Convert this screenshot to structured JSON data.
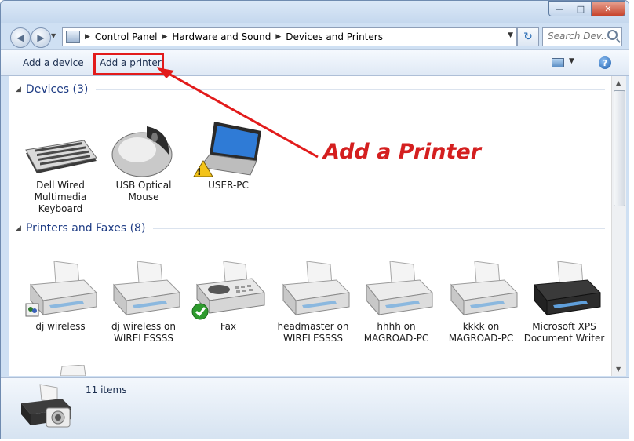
{
  "window": {
    "minimize": "—",
    "maximize": "□",
    "close": "✕"
  },
  "nav": {
    "back_icon": "◀",
    "forward_icon": "▶",
    "dropdown_icon": "▼",
    "refresh_icon": "↻"
  },
  "breadcrumb": {
    "items": [
      "Control Panel",
      "Hardware and Sound",
      "Devices and Printers"
    ],
    "separator": "▶"
  },
  "search": {
    "placeholder": "Search Dev..."
  },
  "toolbar": {
    "add_device": "Add a device",
    "add_printer": "Add a printer",
    "view_dropdown": "▼",
    "help": "?"
  },
  "groups": {
    "devices": {
      "arrow": "◢",
      "title": "Devices (3)",
      "items": [
        "Dell Wired Multimedia Keyboard",
        "USB Optical Mouse",
        "USER-PC"
      ]
    },
    "printers": {
      "arrow": "◢",
      "title": "Printers and Faxes (8)",
      "items": [
        "dj wireless",
        "dj wireless on WIRELESSSS",
        "Fax",
        "headmaster on WIRELESSSS",
        "hhhh on MAGROAD-PC",
        "kkkk on MAGROAD-PC",
        "Microsoft XPS Document Writer"
      ]
    }
  },
  "scroll": {
    "up": "▲",
    "down": "▼"
  },
  "status": {
    "items_count": "11 items"
  },
  "annotation": {
    "text": "Add a Printer",
    "color": "#d41f1f"
  },
  "colors": {
    "group_header": "#1e3c84",
    "toolbar_text": "#1b2e4f",
    "highlight_box": "#e21b1b"
  }
}
